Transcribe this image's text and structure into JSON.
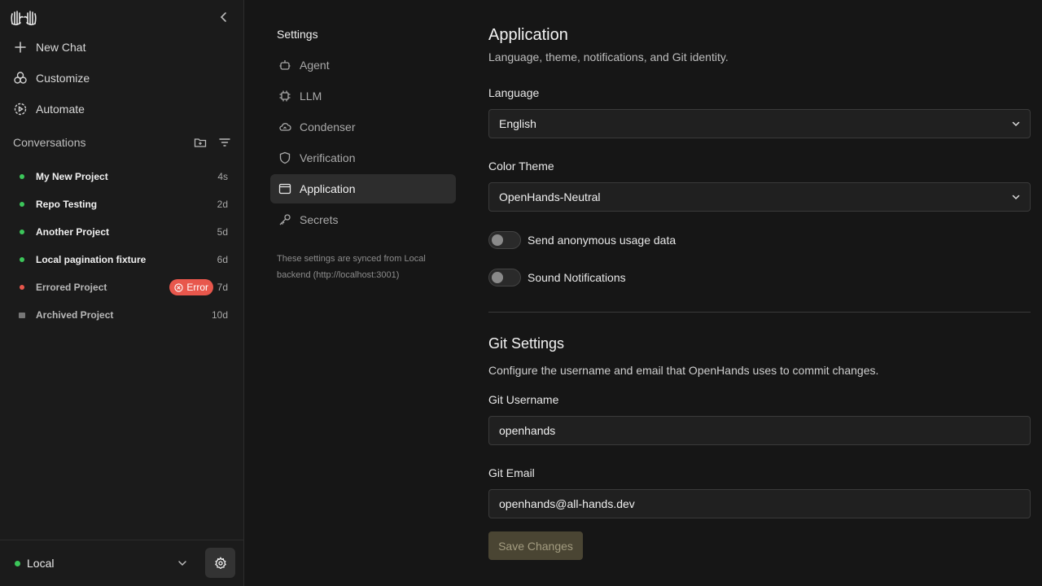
{
  "sidebar": {
    "nav": [
      {
        "label": "New Chat",
        "icon": "plus-icon"
      },
      {
        "label": "Customize",
        "icon": "customize-icon"
      },
      {
        "label": "Automate",
        "icon": "automate-icon"
      }
    ],
    "conversations_title": "Conversations",
    "conversations": [
      {
        "name": "My New Project",
        "time": "4s",
        "status": "active"
      },
      {
        "name": "Repo Testing",
        "time": "2d",
        "status": "active"
      },
      {
        "name": "Another Project",
        "time": "5d",
        "status": "active"
      },
      {
        "name": "Local pagination fixture",
        "time": "6d",
        "status": "active"
      },
      {
        "name": "Errored Project",
        "time": "7d",
        "status": "error",
        "badge": "Error"
      },
      {
        "name": "Archived Project",
        "time": "10d",
        "status": "archived"
      }
    ],
    "footer": {
      "backend": "Local"
    }
  },
  "settings_nav": {
    "title": "Settings",
    "items": [
      {
        "label": "Agent",
        "icon": "robot-icon"
      },
      {
        "label": "LLM",
        "icon": "chip-icon"
      },
      {
        "label": "Condenser",
        "icon": "cloud-icon"
      },
      {
        "label": "Verification",
        "icon": "shield-icon"
      },
      {
        "label": "Application",
        "icon": "window-icon",
        "active": true
      },
      {
        "label": "Secrets",
        "icon": "key-icon"
      }
    ],
    "sync_note": "These settings are synced from Local backend (http://localhost:3001)"
  },
  "main": {
    "title": "Application",
    "subtitle": "Language, theme, notifications, and Git identity.",
    "language_label": "Language",
    "language_value": "English",
    "theme_label": "Color Theme",
    "theme_value": "OpenHands-Neutral",
    "toggle_usage": "Send anonymous usage data",
    "toggle_sound": "Sound Notifications",
    "git_title": "Git Settings",
    "git_subtitle": "Configure the username and email that OpenHands uses to commit changes.",
    "git_username_label": "Git Username",
    "git_username_value": "openhands",
    "git_email_label": "Git Email",
    "git_email_value": "openhands@all-hands.dev",
    "save_label": "Save Changes"
  },
  "colors": {
    "active_dot": "#3cc65a",
    "error_dot": "#e8574c",
    "save_bg": "#4a4533"
  }
}
